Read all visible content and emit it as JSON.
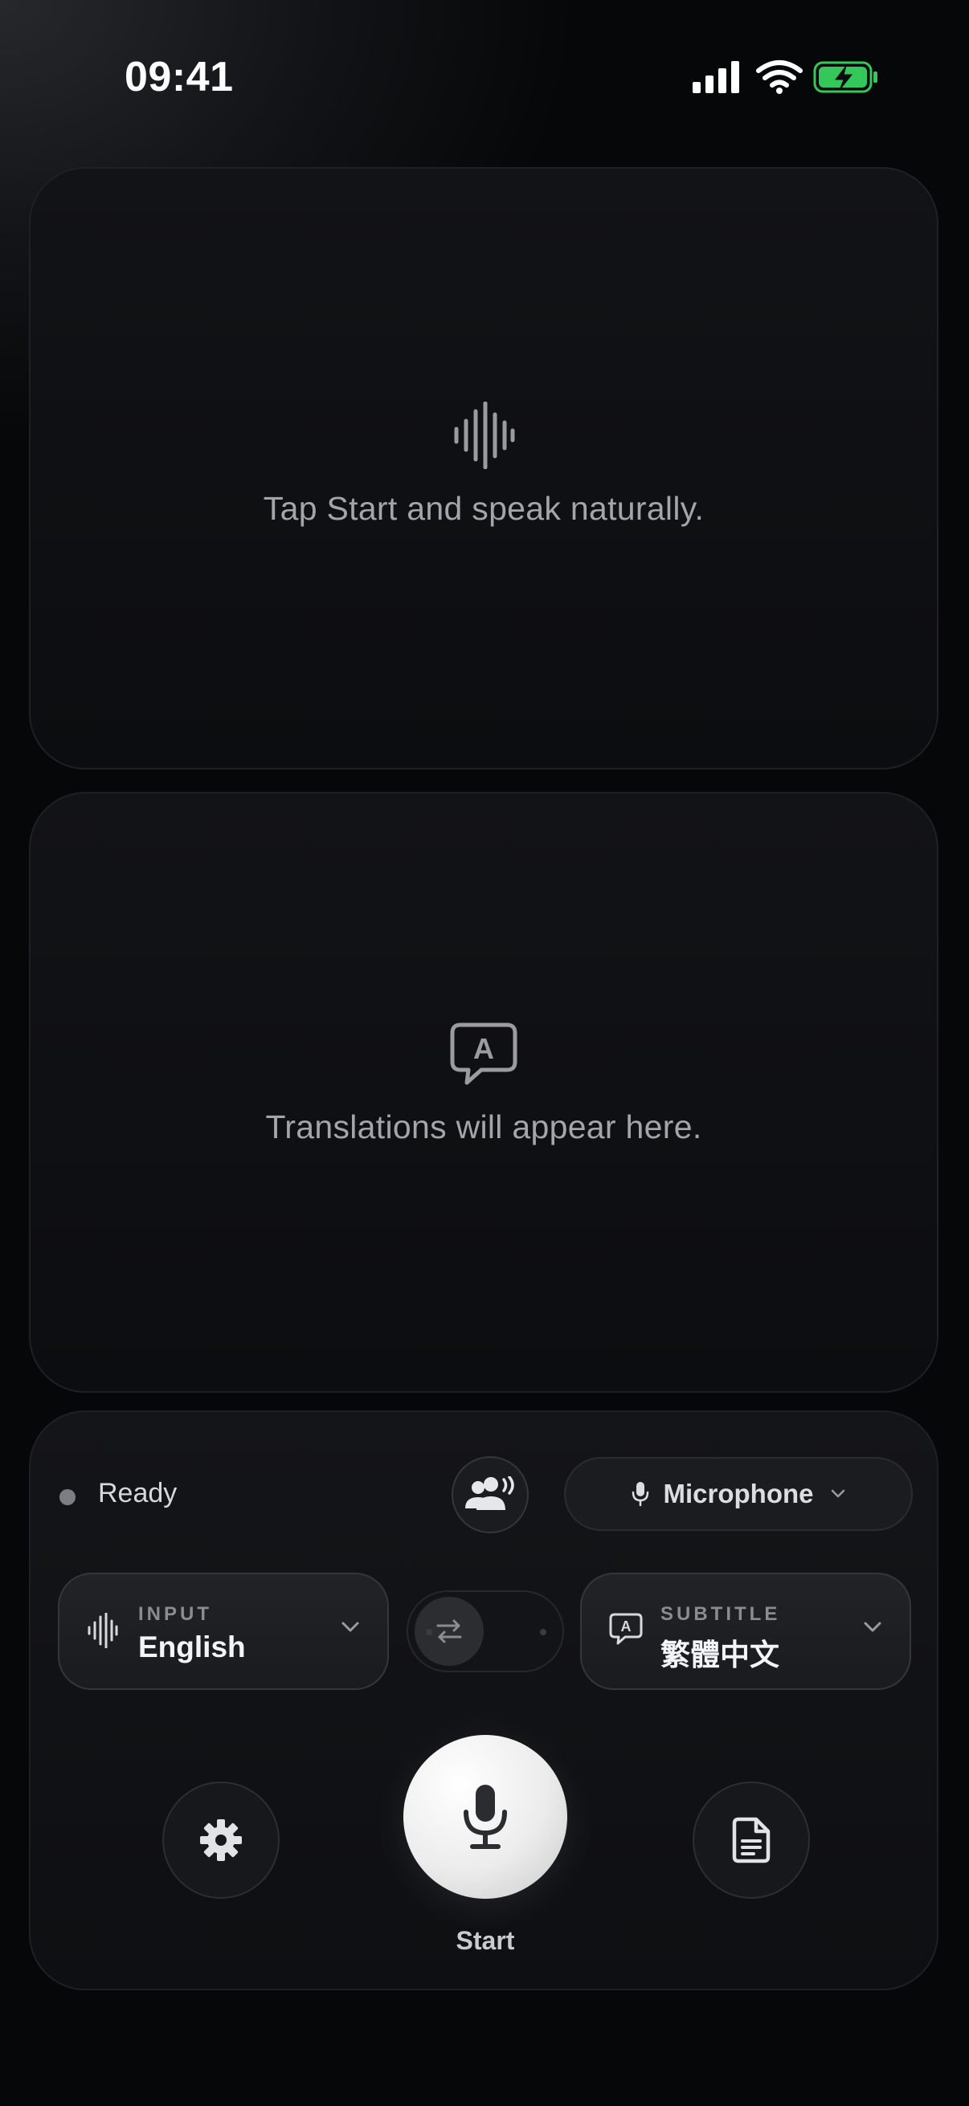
{
  "status_bar": {
    "time": "09:41",
    "icons": [
      "cellular-signal-icon",
      "wifi-icon",
      "battery-charging-icon"
    ]
  },
  "transcript_panel": {
    "icon": "waveform-icon",
    "placeholder": "Tap Start and speak naturally."
  },
  "translation_panel": {
    "icon": "translate-bubble-icon",
    "placeholder": "Translations will appear here."
  },
  "controls": {
    "status_label": "Ready",
    "speaker_mode_icon": "people-speaking-icon",
    "audio_source": {
      "icon": "microphone-icon",
      "label": "Microphone"
    },
    "input_language": {
      "caption": "INPUT",
      "value": "English",
      "icon": "waveform-icon"
    },
    "subtitle_language": {
      "caption": "SUBTITLE",
      "value": "繁體中文",
      "icon": "translate-bubble-icon"
    },
    "swap_icon": "swap-arrows-icon",
    "settings_icon": "gear-icon",
    "notes_icon": "document-icon",
    "start_label": "Start"
  },
  "colors": {
    "background": "#060708",
    "panel": "#0f1013",
    "accent_battery": "#34c759",
    "start_button": "#f0f0f0"
  }
}
